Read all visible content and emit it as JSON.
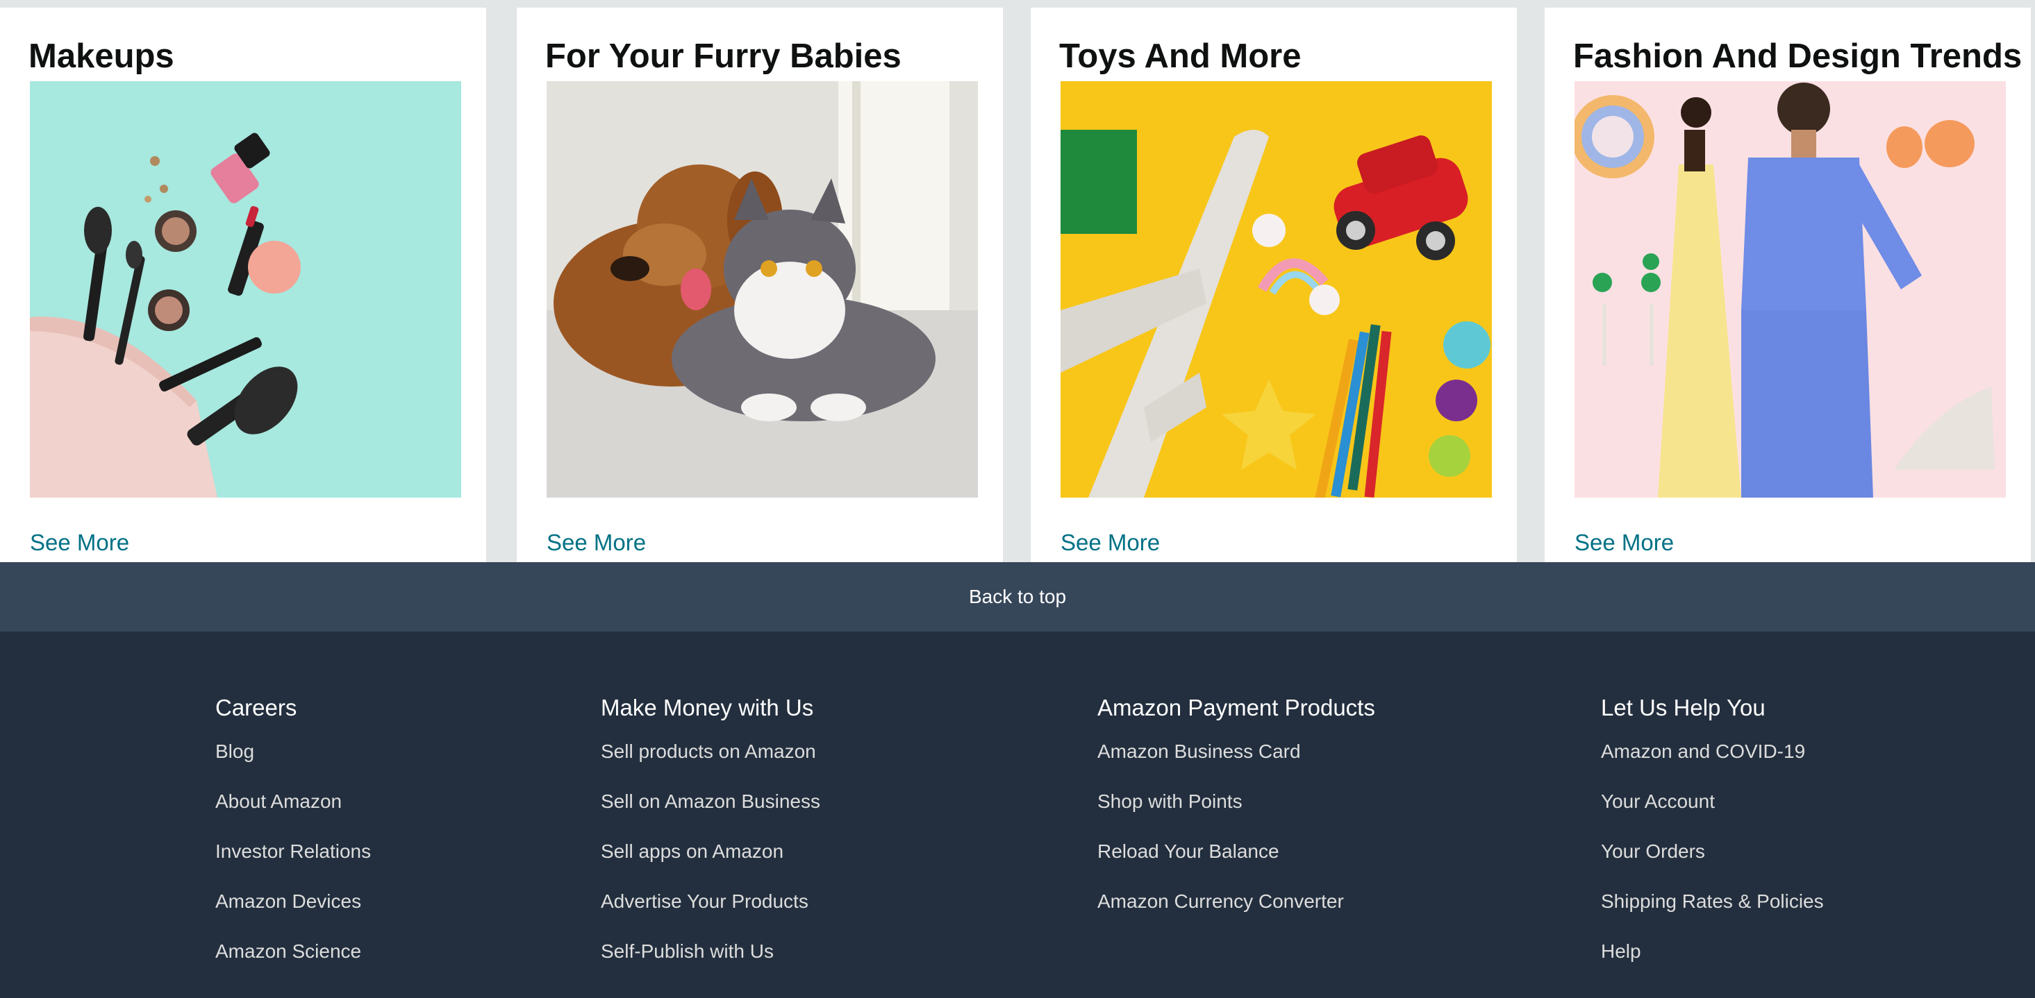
{
  "cards": [
    {
      "title": "Makeups",
      "image": "makeup-products-photo",
      "link": "See More"
    },
    {
      "title": "For Your Furry Babies",
      "image": "dog-and-cat-photo",
      "link": "See More"
    },
    {
      "title": "Toys And More",
      "image": "toys-photo",
      "link": "See More"
    },
    {
      "title": "Fashion And Design Trends",
      "image": "fashion-models-photo",
      "link": "See More"
    }
  ],
  "back_to_top": "Back to top",
  "footer": {
    "columns": [
      {
        "heading": "Careers",
        "links": [
          "Blog",
          "About Amazon",
          "Investor Relations",
          "Amazon Devices",
          "Amazon Science"
        ]
      },
      {
        "heading": "Make Money with Us",
        "links": [
          "Sell products on Amazon",
          "Sell on Amazon Business",
          "Sell apps on Amazon",
          "Advertise Your Products",
          "Self-Publish with Us"
        ]
      },
      {
        "heading": "Amazon Payment Products",
        "links": [
          "Amazon Business Card",
          "Shop with Points",
          "Reload Your Balance",
          "Amazon Currency Converter"
        ]
      },
      {
        "heading": "Let Us Help You",
        "links": [
          "Amazon and COVID-19",
          "Your Account",
          "Your Orders",
          "Shipping Rates & Policies",
          "Help"
        ]
      }
    ]
  },
  "colors": {
    "page_bg": "#e3e6e6",
    "link": "#007185",
    "back_to_top_bg": "#37475a",
    "footer_bg": "#232f3e"
  }
}
